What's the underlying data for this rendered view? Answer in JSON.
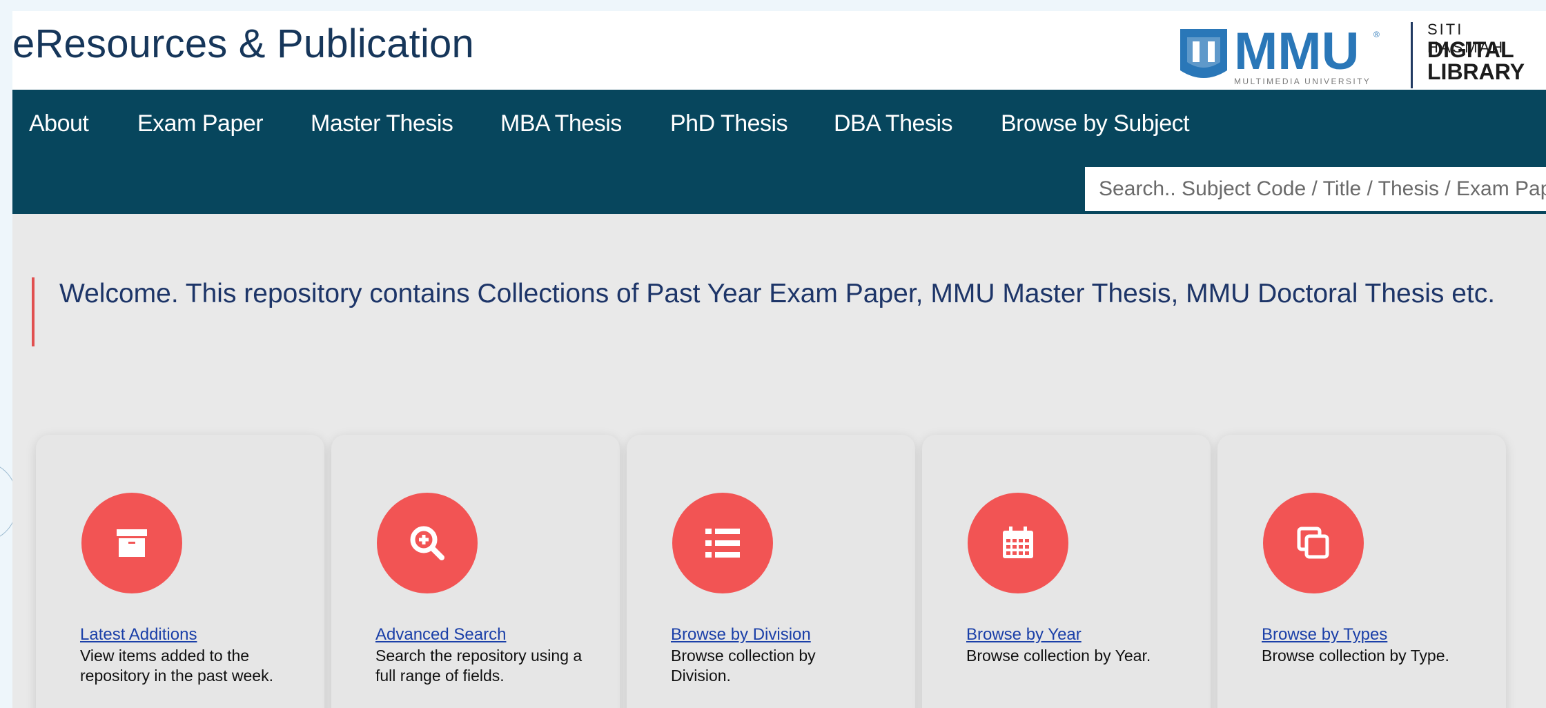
{
  "header": {
    "title": "eResources & Publication",
    "logo": {
      "brand": "MMU",
      "subtitle": "MULTIMEDIA UNIVERSITY"
    },
    "library": {
      "line1": "SITI HASMAH",
      "line2": "DIGITAL",
      "line3": "LIBRARY"
    }
  },
  "nav": {
    "items": [
      "About",
      "Exam Paper",
      "Master Thesis",
      "MBA Thesis",
      "PhD Thesis",
      "DBA Thesis",
      "Browse by Subject"
    ]
  },
  "search": {
    "placeholder": "Search.. Subject Code / Title / Thesis / Exam Paper"
  },
  "welcome": "Welcome. This repository contains Collections of Past Year Exam Paper, MMU Master Thesis, MMU Doctoral Thesis etc.",
  "cards": [
    {
      "link": "Latest Additions",
      "desc": "View items added to the repository in the past week.",
      "icon": "archive-icon"
    },
    {
      "link": "Advanced Search",
      "desc": "Search the repository using a full range of fields.",
      "icon": "zoom-in-icon"
    },
    {
      "link": "Browse by Division",
      "desc": "Browse collection by Division.",
      "icon": "list-icon"
    },
    {
      "link": "Browse by Year",
      "desc": "Browse collection by Year.",
      "icon": "calendar-icon"
    },
    {
      "link": "Browse by Types",
      "desc": "Browse collection by Type.",
      "icon": "copy-icon"
    }
  ],
  "colors": {
    "navbar": "#07465d",
    "accent": "#f25454",
    "link": "#1a3fa8",
    "title": "#16365a"
  }
}
